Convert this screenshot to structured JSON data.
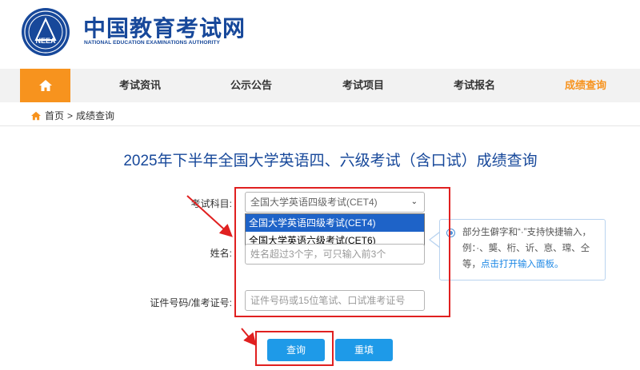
{
  "header": {
    "brand_cn": "中国教育考试网",
    "brand_en": "NATIONAL EDUCATION EXAMINATIONS AUTHORITY",
    "logo_text": "NEEA"
  },
  "nav": {
    "items": [
      {
        "label": "考试资讯"
      },
      {
        "label": "公示公告"
      },
      {
        "label": "考试项目"
      },
      {
        "label": "考试报名"
      },
      {
        "label": "成绩查询"
      }
    ]
  },
  "breadcrumb": {
    "home": "首页",
    "separator": ">",
    "current": "成绩查询"
  },
  "page_title": "2025年下半年全国大学英语四、六级考试（含口试）成绩查询",
  "form": {
    "subject_label": "考试科目:",
    "subject_value": "全国大学英语四级考试(CET4)",
    "subject_options": [
      "全国大学英语四级考试(CET4)",
      "全国大学英语六级考试(CET6)"
    ],
    "name_label": "姓名:",
    "name_placeholder": "姓名超过3个字，可只输入前3个",
    "id_label": "证件号码/准考证号:",
    "id_placeholder": "证件号码或15位笔试、口试准考证号"
  },
  "tooltip": {
    "text": "部分生僻字和“·”支持快捷输入，例：·、龑、桁、䜣、恴、瑺、仝等，",
    "link": "点击打开输入面板。"
  },
  "buttons": {
    "query": "查询",
    "reset": "重填"
  },
  "colors": {
    "brand_blue": "#17489a",
    "accent_orange": "#f7931e",
    "button_blue": "#1e9ae8",
    "highlight_red": "#e02020"
  }
}
